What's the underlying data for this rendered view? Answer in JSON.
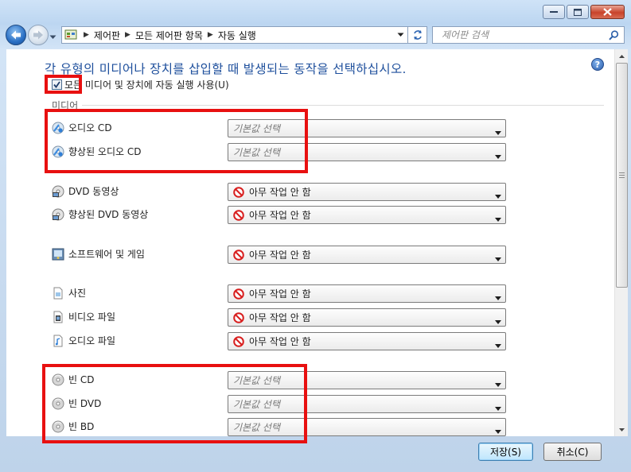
{
  "nav": {
    "breadcrumbs": [
      "제어판",
      "모든 제어판 항목",
      "자동 실행"
    ],
    "search_placeholder": "제어판 검색"
  },
  "heading": "각 유형의 미디어나 장치를 삽입할 때 발생되는 동작을 선택하십시오.",
  "help_label": "?",
  "master_checkbox": {
    "label": "모든 미디어 및 장치에 자동 실행 사용(U)",
    "checked": true
  },
  "section": {
    "label": "미디어"
  },
  "rows": [
    {
      "label": "오디오 CD",
      "icon": "audio-cd-icon",
      "value": "기본값 선택",
      "is_default": true
    },
    {
      "label": "향상된 오디오 CD",
      "icon": "audio-cd-icon",
      "value": "기본값 선택",
      "is_default": true
    },
    {
      "label": "DVD 동영상",
      "icon": "dvd-movie-icon",
      "value": "아무 작업 안 함",
      "is_default": false
    },
    {
      "label": "향상된 DVD 동영상",
      "icon": "dvd-movie-icon",
      "value": "아무 작업 안 함",
      "is_default": false
    },
    {
      "label": "소프트웨어 및 게임",
      "icon": "software-games-icon",
      "value": "아무 작업 안 함",
      "is_default": false
    },
    {
      "label": "사진",
      "icon": "picture-file-icon",
      "value": "아무 작업 안 함",
      "is_default": false
    },
    {
      "label": "비디오 파일",
      "icon": "video-file-icon",
      "value": "아무 작업 안 함",
      "is_default": false
    },
    {
      "label": "오디오 파일",
      "icon": "audio-file-icon",
      "value": "아무 작업 안 함",
      "is_default": false
    },
    {
      "label": "빈 CD",
      "icon": "blank-disc-icon",
      "value": "기본값 선택",
      "is_default": true
    },
    {
      "label": "빈 DVD",
      "icon": "blank-disc-icon",
      "value": "기본값 선택",
      "is_default": true
    },
    {
      "label": "빈 BD",
      "icon": "blank-disc-icon",
      "value": "기본값 선택",
      "is_default": true
    }
  ],
  "buttons": {
    "save": "저장(S)",
    "cancel": "취소(C)"
  },
  "colors": {
    "heading": "#1e4f9c",
    "annotation": "#e81010",
    "no_action": "#d81e1e"
  }
}
